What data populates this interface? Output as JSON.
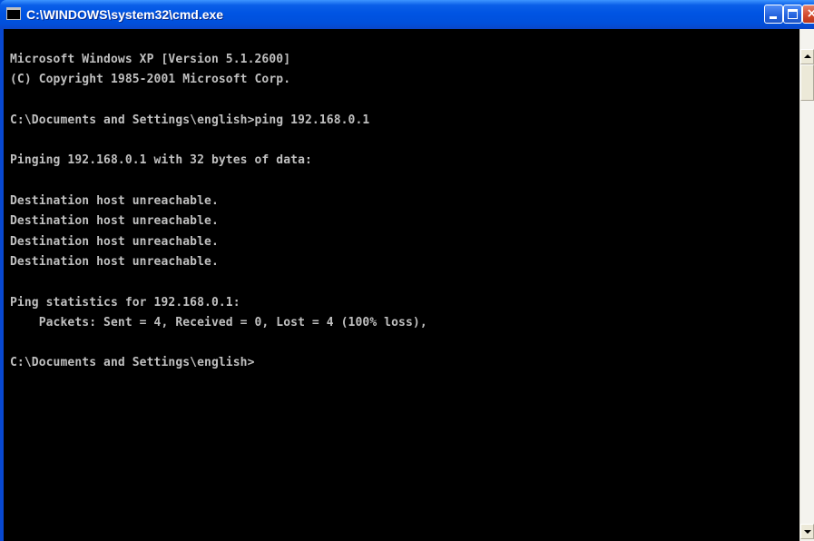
{
  "window": {
    "title": "C:\\WINDOWS\\system32\\cmd.exe",
    "icon": "cmd-icon",
    "icon_text": "C:\\"
  },
  "controls": {
    "minimize": "minimize-icon",
    "maximize": "maximize-icon",
    "close": "close-icon",
    "close_glyph": "×"
  },
  "console": {
    "lines": [
      "Microsoft Windows XP [Version 5.1.2600]",
      "(C) Copyright 1985-2001 Microsoft Corp.",
      "",
      "C:\\Documents and Settings\\english>ping 192.168.0.1",
      "",
      "Pinging 192.168.0.1 with 32 bytes of data:",
      "",
      "Destination host unreachable.",
      "Destination host unreachable.",
      "Destination host unreachable.",
      "Destination host unreachable.",
      "",
      "Ping statistics for 192.168.0.1:",
      "    Packets: Sent = 4, Received = 0, Lost = 4 (100% loss),",
      "",
      "C:\\Documents and Settings\\english>"
    ]
  },
  "colors": {
    "titlebar": "#0054e3",
    "console_background": "#000000",
    "console_text": "#c0c0c0",
    "close_button": "#d3482a"
  }
}
